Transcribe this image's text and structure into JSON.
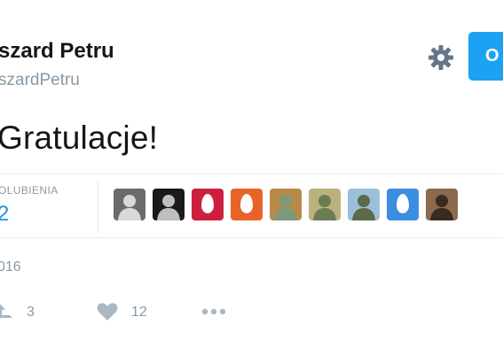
{
  "author": {
    "display_name": "szard Petru",
    "handle": "szardPetru"
  },
  "follow_button": {
    "label": "O",
    "color": "#1da1f2"
  },
  "tweet": {
    "text": "Gratulacje!"
  },
  "stats": {
    "likes_label": "OLUBIENIA",
    "likes_count": "2"
  },
  "likers": [
    {
      "icon": "avatar-photo-woman-icon",
      "kind": "photo",
      "bg": "#6b6b6b",
      "fg": "#d9d9d9"
    },
    {
      "icon": "avatar-photo-bw-icon",
      "kind": "photo",
      "bg": "#1a1a1a",
      "fg": "#bfbfbf"
    },
    {
      "icon": "default-egg-avatar-icon",
      "kind": "egg",
      "bg": "#cc1f3d"
    },
    {
      "icon": "default-egg-avatar-icon",
      "kind": "egg",
      "bg": "#e8632a"
    },
    {
      "icon": "avatar-photo-outdoor-icon",
      "kind": "photo",
      "bg": "#b88a4a",
      "fg": "#7a9a7a"
    },
    {
      "icon": "avatar-photo-field-icon",
      "kind": "photo",
      "bg": "#b9b27c",
      "fg": "#6b7c52"
    },
    {
      "icon": "avatar-photo-sky-icon",
      "kind": "photo",
      "bg": "#9cbfd9",
      "fg": "#5a6a4a"
    },
    {
      "icon": "default-egg-avatar-icon",
      "kind": "egg",
      "bg": "#3a8de0"
    },
    {
      "icon": "avatar-photo-man-icon",
      "kind": "photo",
      "bg": "#8b6a4d",
      "fg": "#3b2a1e"
    }
  ],
  "timestamp": {
    "text": "016"
  },
  "actions": {
    "retweet_count": "3",
    "like_count": "12"
  },
  "colors": {
    "text": "#14171a",
    "secondary": "#8899a6",
    "link": "#1b95e0",
    "divider": "#e6ecf0"
  }
}
